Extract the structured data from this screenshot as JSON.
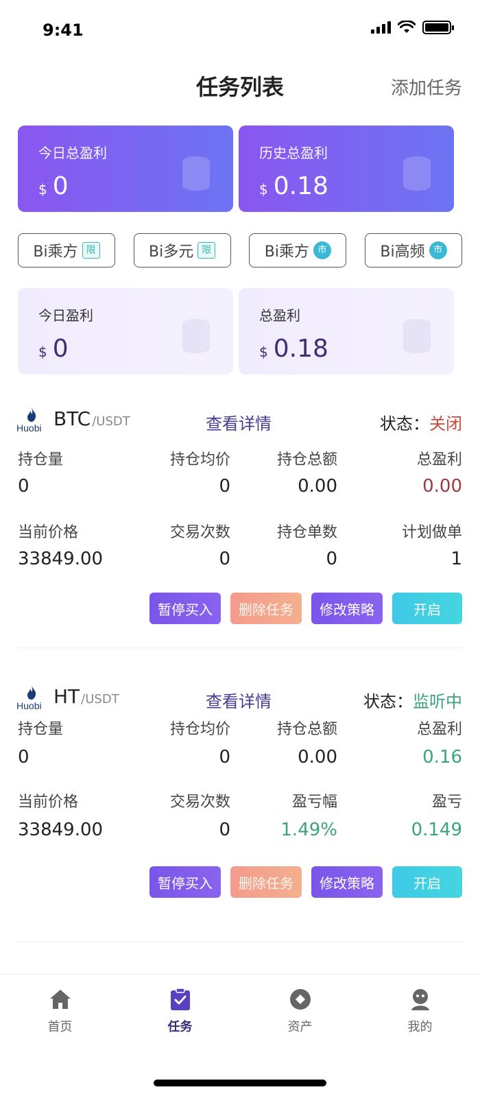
{
  "status_bar": {
    "time": "9:41"
  },
  "header": {
    "title": "任务列表",
    "add_task": "添加任务"
  },
  "profit_cards": [
    {
      "label": "今日总盈利",
      "currency": "$",
      "value": "0"
    },
    {
      "label": "历史总盈利",
      "currency": "$",
      "value": "0.18"
    }
  ],
  "strategies": [
    {
      "name": "Bi乘方",
      "tag": "限"
    },
    {
      "name": "Bi多元",
      "tag": "限"
    },
    {
      "name": "Bi乘方",
      "tag": "市"
    },
    {
      "name": "Bi高频",
      "tag": "市"
    }
  ],
  "strategy_profit": [
    {
      "label": "今日盈利",
      "currency": "$",
      "value": "0"
    },
    {
      "label": "总盈利",
      "currency": "$",
      "value": "0.18"
    }
  ],
  "exchange_logo": {
    "text_a": "Huo",
    "text_b": "bi"
  },
  "tasks": [
    {
      "base": "BTC",
      "quote": "/USDT",
      "view_detail": "查看详情",
      "status_label": "状态：",
      "status_value": "关闭",
      "row1_labels": [
        "持仓量",
        "持仓均价",
        "持仓总额",
        "总盈利"
      ],
      "row1_values": [
        "0",
        "0",
        "0.00",
        "0.00"
      ],
      "row2_labels": [
        "当前价格",
        "交易次数",
        "持仓单数",
        "计划做单"
      ],
      "row2_values": [
        "33849.00",
        "0",
        "0",
        "1"
      ],
      "actions": [
        "暂停买入",
        "删除任务",
        "修改策略",
        "开启"
      ]
    },
    {
      "base": "HT",
      "quote": "/USDT",
      "view_detail": "查看详情",
      "status_label": "状态：",
      "status_value": "监听中",
      "row1_labels": [
        "持仓量",
        "持仓均价",
        "持仓总额",
        "总盈利"
      ],
      "row1_values": [
        "0",
        "0",
        "0.00",
        "0.16"
      ],
      "row2_labels": [
        "当前价格",
        "交易次数",
        "盈亏幅",
        "盈亏"
      ],
      "row2_values": [
        "33849.00",
        "0",
        "1.49%",
        "0.149"
      ],
      "actions": [
        "暂停买入",
        "删除任务",
        "修改策略",
        "开启"
      ]
    }
  ],
  "tabbar": [
    {
      "label": "首页",
      "icon": "home-icon",
      "active": false
    },
    {
      "label": "任务",
      "icon": "task-clipboard-icon",
      "active": true
    },
    {
      "label": "资产",
      "icon": "asset-icon",
      "active": false
    },
    {
      "label": "我的",
      "icon": "profile-icon",
      "active": false
    }
  ],
  "colors": {
    "accent_purple": "#7a55e8",
    "status_closed": "#c74a3c",
    "status_listening": "#3aa380",
    "open_button": "#3fc9e6"
  }
}
